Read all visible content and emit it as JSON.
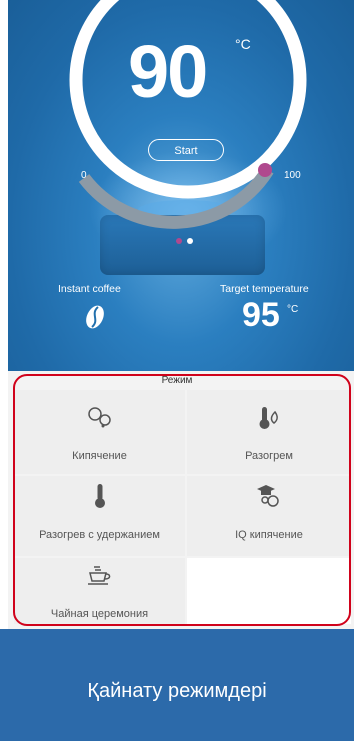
{
  "heater": {
    "current_temp": "90",
    "unit": "°C",
    "start_label": "Start",
    "scale_min": "0",
    "scale_max": "100",
    "instant_label": "Instant coffee",
    "target_label": "Target temperature",
    "target_value": "95",
    "target_unit": "°C",
    "colors": {
      "accent": "#b0498e",
      "hero_bg": "#1f6aa8"
    }
  },
  "modes": {
    "title": "Режим",
    "items": [
      {
        "label": "Кипячение",
        "icon": "bubbles-icon"
      },
      {
        "label": "Разогрем",
        "icon": "thermometer-flame-icon"
      },
      {
        "label": "Разогрев с удержанием",
        "icon": "thermometer-icon"
      },
      {
        "label": "IQ кипячение",
        "icon": "graduation-bubbles-icon"
      },
      {
        "label": "Чайная церемония",
        "icon": "teapot-icon"
      }
    ]
  },
  "footer": {
    "title": "Қайнату режимдері"
  }
}
